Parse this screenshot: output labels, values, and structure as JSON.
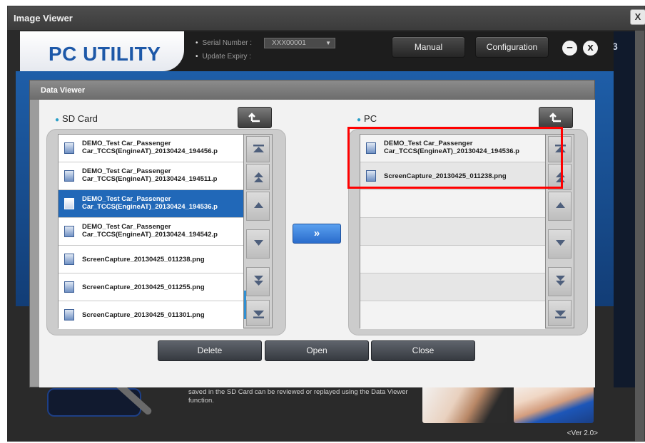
{
  "outer_window": {
    "title": "Image Viewer",
    "close_label": "X",
    "right_edge_text": "3",
    "version": "<Ver 2.0>",
    "description_text": "saved in the SD Card can be reviewed or replayed using the Data Viewer function."
  },
  "header": {
    "logo": "PC UTILITY",
    "serial_label": "Serial Number :",
    "serial_value": "XXX00001",
    "update_label": "Update Expiry :",
    "manual_button": "Manual",
    "configuration_button": "Configuration",
    "minimize_label": "–",
    "close_label": "x"
  },
  "dialog": {
    "title": "Data Viewer",
    "sd_card": {
      "title": "SD Card",
      "items": [
        {
          "line1": "DEMO_Test Car_Passenger",
          "line2": "Car_TCCS(EngineAT)_20130424_194456.p",
          "selected": false
        },
        {
          "line1": "DEMO_Test Car_Passenger",
          "line2": "Car_TCCS(EngineAT)_20130424_194511.p",
          "selected": false
        },
        {
          "line1": "DEMO_Test Car_Passenger",
          "line2": "Car_TCCS(EngineAT)_20130424_194536.p",
          "selected": true
        },
        {
          "line1": "DEMO_Test Car_Passenger",
          "line2": "Car_TCCS(EngineAT)_20130424_194542.p",
          "selected": false
        },
        {
          "line1": "ScreenCapture_20130425_011238.png",
          "line2": "",
          "selected": false
        },
        {
          "line1": "ScreenCapture_20130425_011255.png",
          "line2": "",
          "selected": false
        },
        {
          "line1": "ScreenCapture_20130425_011301.png",
          "line2": "",
          "selected": false
        }
      ],
      "scroll_position": 0.95
    },
    "pc": {
      "title": "PC",
      "items": [
        {
          "line1": "DEMO_Test Car_Passenger",
          "line2": "Car_TCCS(EngineAT)_20130424_194536.p"
        },
        {
          "line1": "ScreenCapture_20130425_011238.png",
          "line2": ""
        }
      ]
    },
    "transfer_button": "»",
    "delete_button": "Delete",
    "open_button": "Open",
    "close_button": "Close"
  },
  "colors": {
    "selected_row": "#2168b8",
    "logo_blue": "#1d58a8",
    "highlight_red": "#ff0000",
    "transfer_blue": "#3a80dc"
  }
}
